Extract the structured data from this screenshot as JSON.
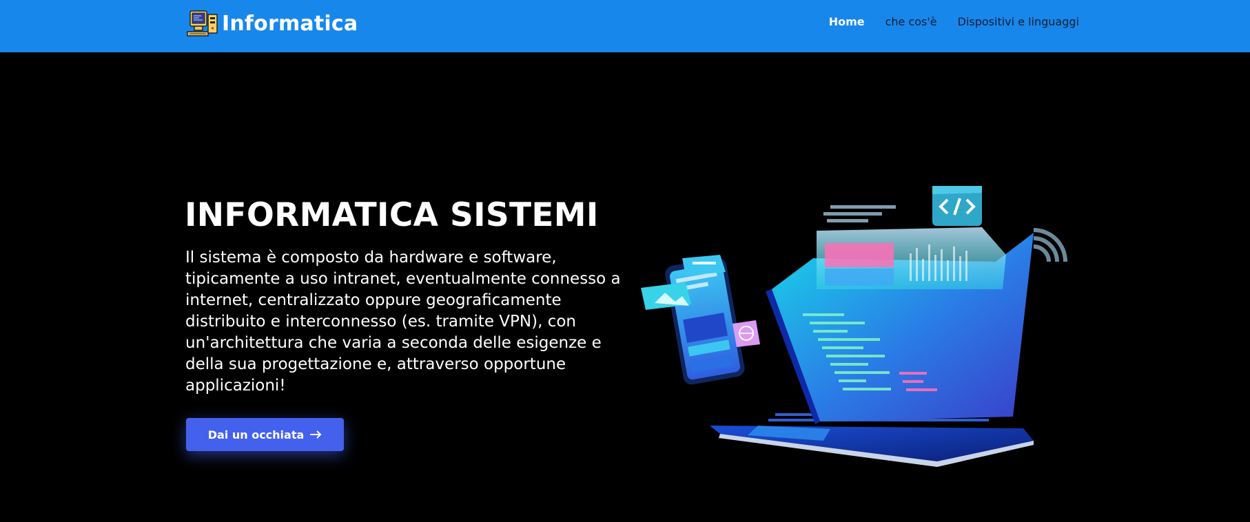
{
  "header": {
    "brand_name": "Informatica",
    "brand_icon": "retro-computer-icon",
    "nav": [
      {
        "label": "Home",
        "active": true
      },
      {
        "label": "che cos'è",
        "active": false
      },
      {
        "label": "Dispositivi e linguaggi",
        "active": false
      }
    ]
  },
  "hero": {
    "title": "INFORMATICA SISTEMI",
    "text": "Il sistema è composto da hardware e software, tipicamente a uso intranet, eventualmente connesso a internet, centralizzato oppure geograficamente distribuito e interconnesso (es. tramite VPN), con un'architettura che varia a seconda delle esigenze e della sua progettazione e, attraverso opportune applicazioni!",
    "cta_label": "Dai un occhiata",
    "cta_icon": "arrow-right-icon",
    "illustration": "laptop-phone-code-illustration"
  },
  "colors": {
    "header_bg": "#1787ec",
    "page_bg": "#000000",
    "cta_bg": "#4461ee",
    "nav_text": "#0f1c2e"
  }
}
